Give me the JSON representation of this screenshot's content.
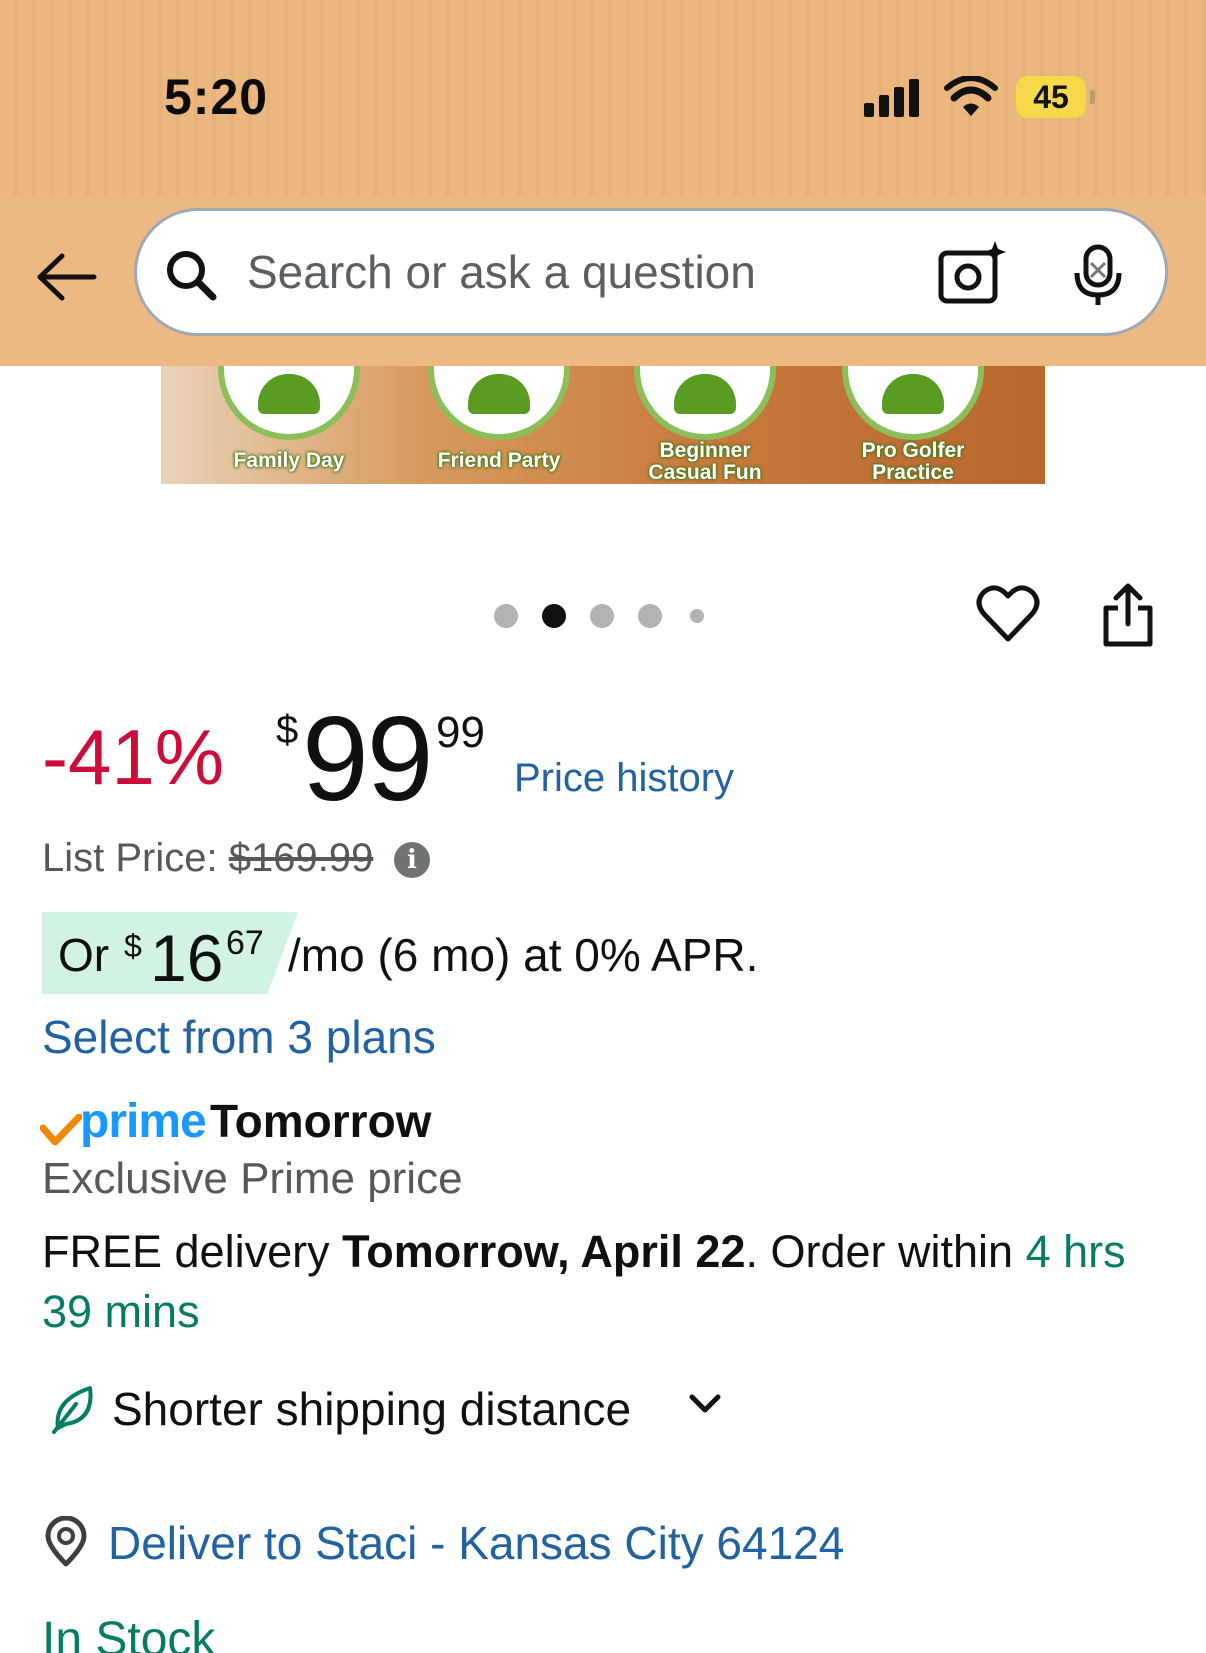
{
  "status_bar": {
    "time": "5:20",
    "battery": "45"
  },
  "search": {
    "placeholder": "Search or ask a question"
  },
  "banner": {
    "items": [
      {
        "label": "Family Day"
      },
      {
        "label": "Friend Party"
      },
      {
        "label": "Beginner Casual Fun"
      },
      {
        "label": "Pro Golfer Practice"
      }
    ]
  },
  "carousel": {
    "total": 5,
    "active_index": 1
  },
  "price": {
    "discount": "-41%",
    "currency": "$",
    "whole": "99",
    "fraction": "99",
    "price_history_link": "Price history",
    "list_price_label": "List Price:",
    "list_price_value": "$169.99",
    "info_glyph": "i"
  },
  "installment": {
    "or": "Or",
    "currency": "$",
    "whole": "16",
    "fraction": "67",
    "terms": "/mo (6 mo) at 0% APR.",
    "select_plans": "Select from 3 plans"
  },
  "prime": {
    "badge": "prime",
    "delivery_day": "Tomorrow",
    "exclusive_text": "Exclusive Prime price",
    "brand_colors": {
      "prime_blue": "#1a98ff",
      "check_orange": "#f08804"
    }
  },
  "delivery": {
    "prefix": "FREE delivery ",
    "date": "Tomorrow, April 22",
    "middle": ". Order within ",
    "countdown": "4 hrs 39 mins"
  },
  "sustainability": {
    "label": "Shorter shipping distance"
  },
  "location": {
    "text": "Deliver to Staci - Kansas City 64124"
  },
  "stock": {
    "status": "In Stock"
  },
  "colors": {
    "header_bg": "#edb983",
    "discount_red": "#cc0c39",
    "link_blue": "#2162a1",
    "success_green": "#067d62",
    "installment_bg": "#d3f3e2"
  }
}
